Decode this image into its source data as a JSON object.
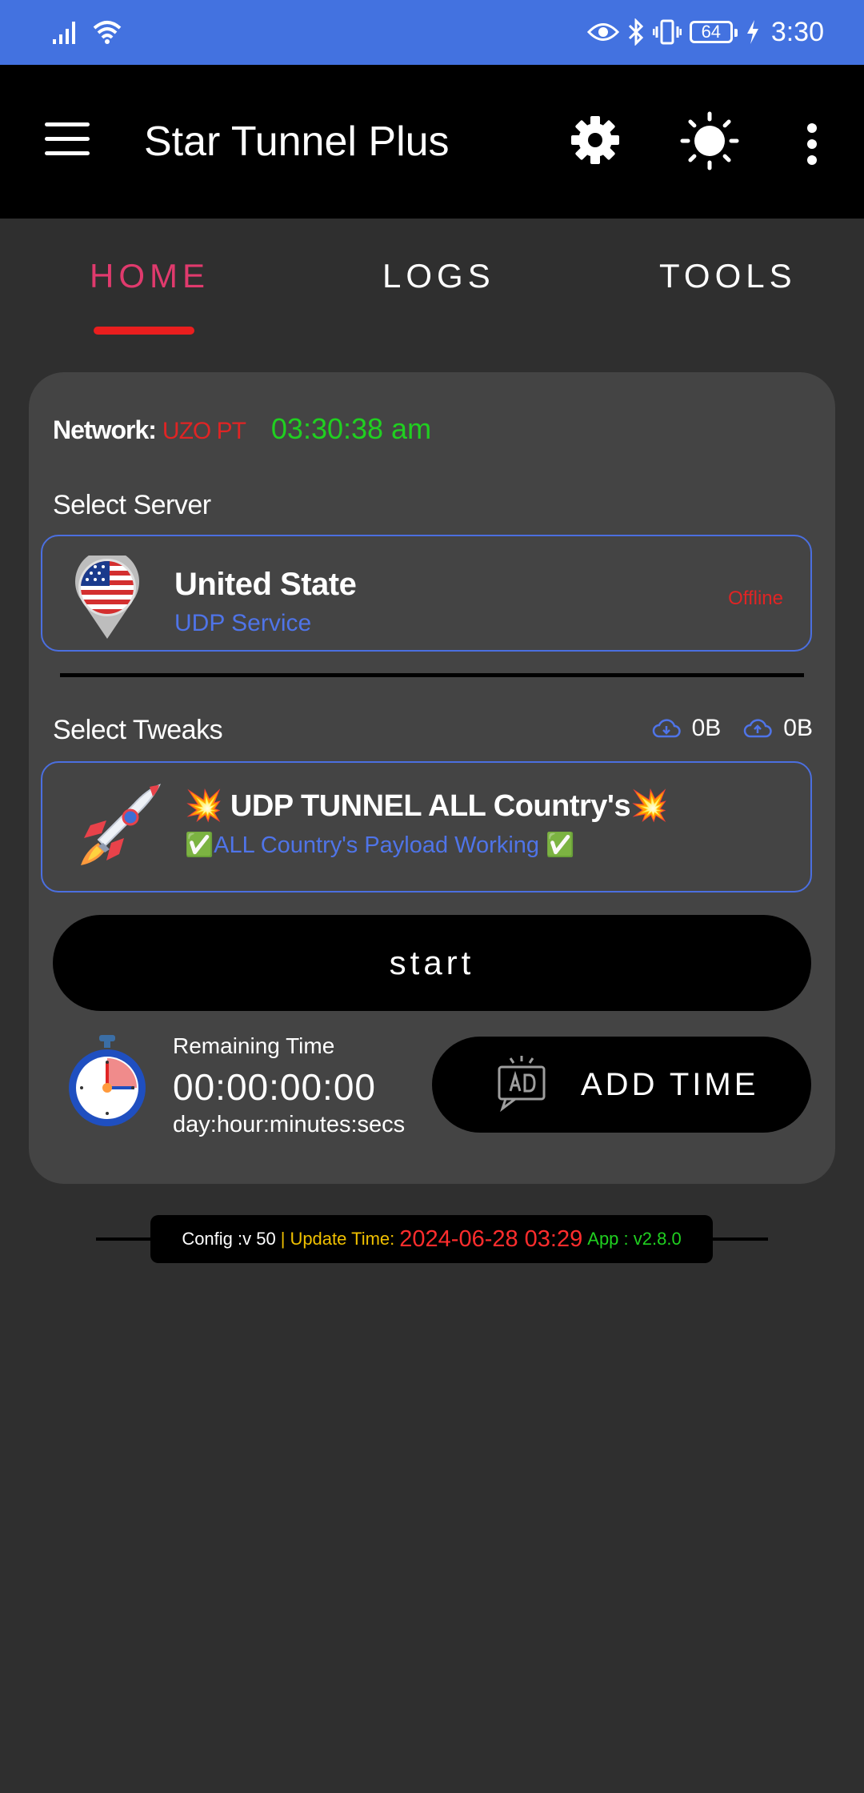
{
  "status_bar": {
    "time": "3:30",
    "battery": "64",
    "icons": [
      "signal-icon",
      "wifi-icon",
      "eye-icon",
      "bluetooth-icon",
      "vibrate-icon",
      "battery-icon",
      "charging-icon"
    ]
  },
  "app_bar": {
    "title": "Star Tunnel Plus",
    "icons": [
      "menu-icon",
      "gear-icon",
      "sun-icon",
      "more-vertical-icon"
    ]
  },
  "tabs": [
    {
      "label": "HOME",
      "active": true
    },
    {
      "label": "LOGS",
      "active": false
    },
    {
      "label": "TOOLS",
      "active": false
    }
  ],
  "network": {
    "label": "Network:",
    "value": "UZO PT",
    "clock": "03:30:38 am"
  },
  "server": {
    "section_label": "Select Server",
    "name": "United State",
    "type": "UDP Service",
    "status": "Offline",
    "flag_icon": "us-flag-pin-icon"
  },
  "tweaks": {
    "section_label": "Select Tweaks",
    "download": "0B",
    "upload": "0B",
    "title": "💥 UDP TUNNEL ALL Country's💥",
    "subtitle": "✅ALL Country's Payload Working ✅",
    "icon": "rocket-icon"
  },
  "start_button": {
    "label": "start"
  },
  "remaining": {
    "label": "Remaining Time",
    "value": "00:00:00:00",
    "format": "day:hour:minutes:secs"
  },
  "add_time_button": {
    "label": "ADD TIME",
    "icon": "ad-icon"
  },
  "footer": {
    "config": "Config :v 50",
    "separator": "|",
    "update_label": "Update Time:",
    "update_value": "2024-06-28 03:29",
    "app_version": "App : v2.8.0"
  },
  "colors": {
    "status_bar": "#4372e0",
    "active_tab": "#e03a6d",
    "indicator": "#e91e1e",
    "accent_blue": "#4f74e8",
    "clock_green": "#20d020",
    "offline_red": "#e02424"
  }
}
